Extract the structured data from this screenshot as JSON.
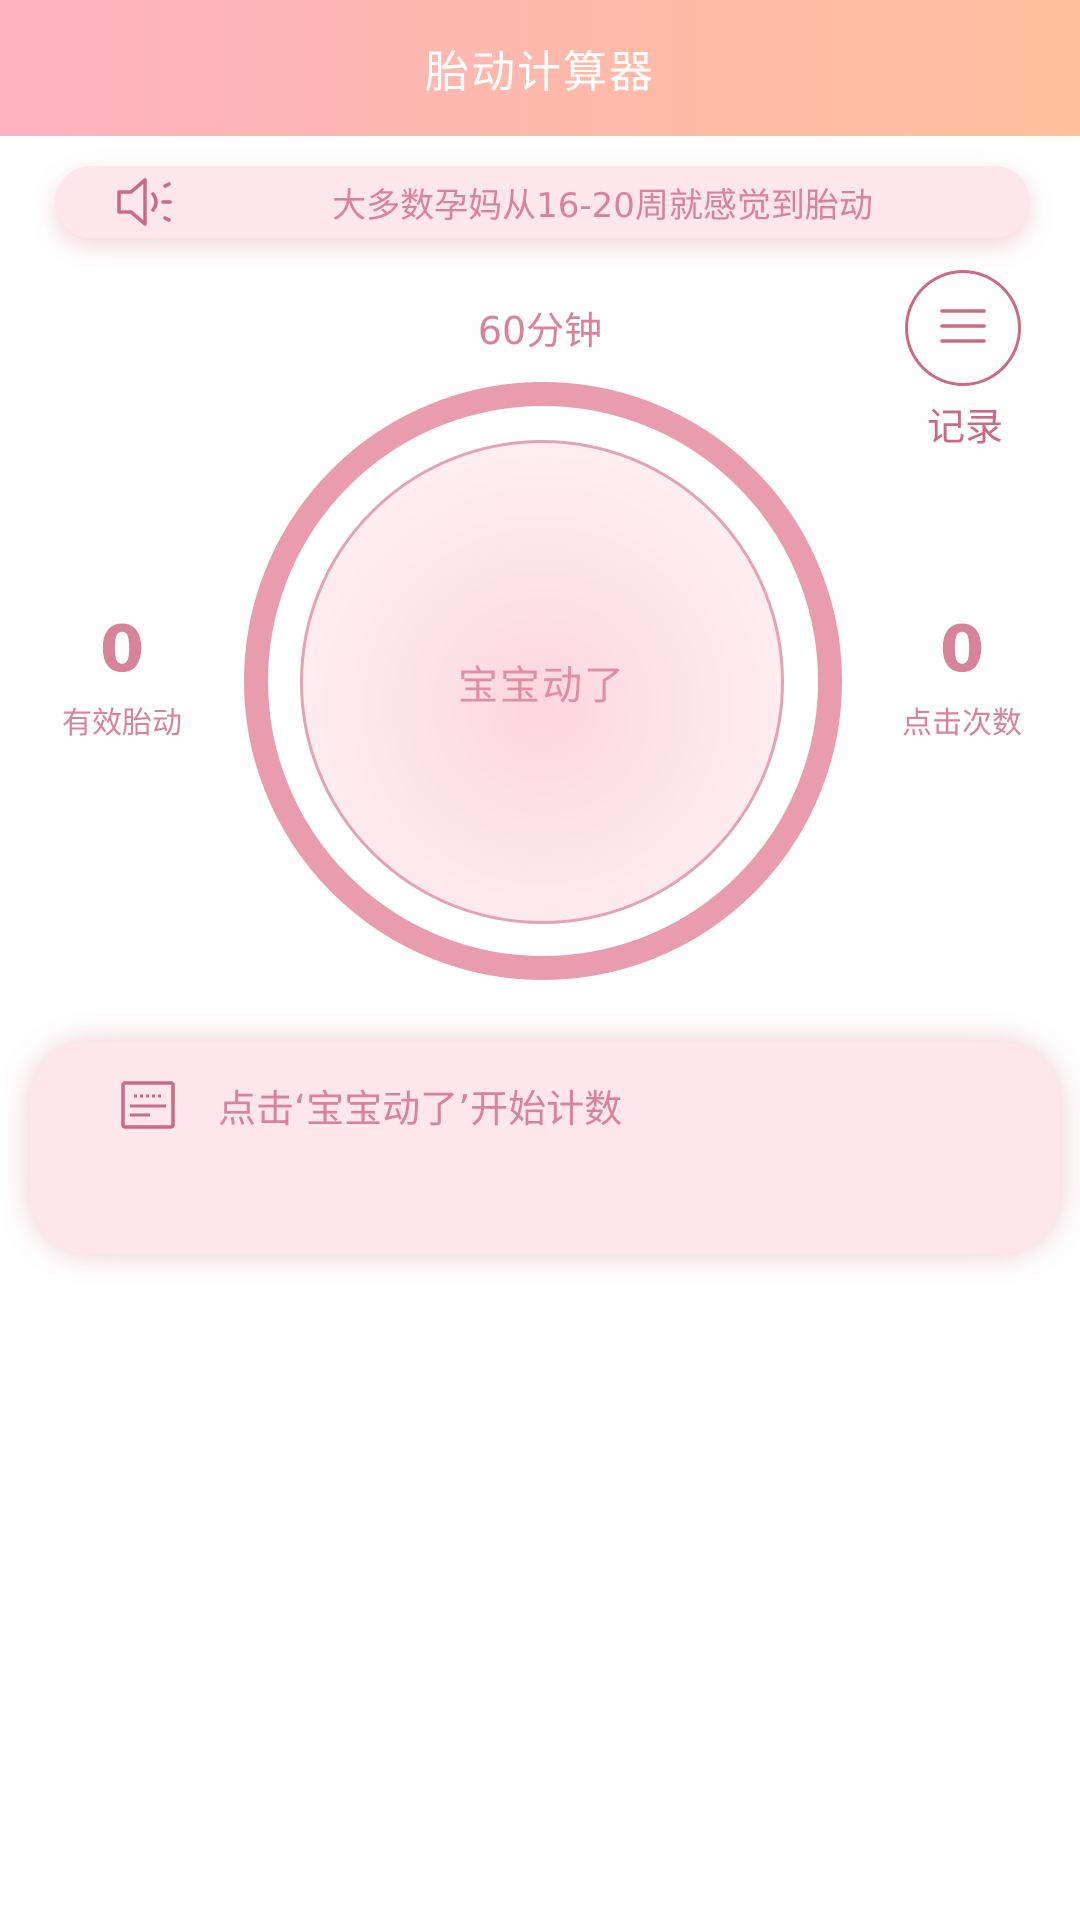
{
  "header": {
    "title": "胎动计算器"
  },
  "tip": {
    "text": "大多数孕妈从16-20周就感觉到胎动",
    "icon": "speaker-icon"
  },
  "timer": {
    "label": "60分钟"
  },
  "record": {
    "label": "记录",
    "icon": "menu-icon"
  },
  "stats": {
    "effective": {
      "value": "0",
      "label": "有效胎动"
    },
    "clicks": {
      "value": "0",
      "label": "点击次数"
    }
  },
  "main_button": {
    "label": "宝宝动了"
  },
  "info": {
    "text": "点击‘宝宝动了’开始计数",
    "icon": "note-icon"
  },
  "colors": {
    "accent": "#e89cad",
    "text": "#d8839a",
    "header_start": "#ffb3c1",
    "header_end": "#ffc09c"
  }
}
